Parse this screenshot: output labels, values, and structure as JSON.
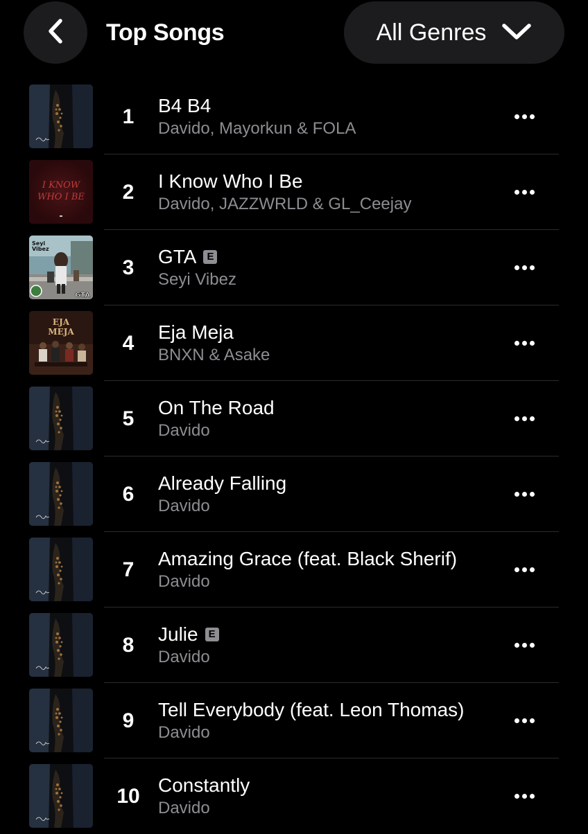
{
  "header": {
    "back_icon": "chevron-left-icon",
    "title": "Top Songs",
    "genre_label": "All Genres",
    "genre_icon": "chevron-down-icon"
  },
  "explicit_badge": "E",
  "colors": {
    "background": "#000000",
    "button_bg": "#1c1c1e",
    "secondary_text": "#8d8d92",
    "divider": "#2c2c2e"
  },
  "songs": [
    {
      "rank": "1",
      "title": "B4 B4",
      "artist": "Davido, Mayorkun & FOLA",
      "explicit": false,
      "artwork": "davido-album"
    },
    {
      "rank": "2",
      "title": "I Know Who I Be",
      "artist": "Davido, JAZZWRLD & GL_Ceejay",
      "explicit": false,
      "artwork": "i-know-who-i-be-cover",
      "artwork_text": [
        "I KNOW",
        "WHO I BE"
      ]
    },
    {
      "rank": "3",
      "title": "GTA",
      "artist": "Seyi Vibez",
      "explicit": true,
      "artwork": "gta-cover",
      "artwork_text": [
        "Seyi",
        "Vibez",
        "GTA"
      ]
    },
    {
      "rank": "4",
      "title": "Eja Meja",
      "artist": "BNXN & Asake",
      "explicit": false,
      "artwork": "eja-meja-cover",
      "artwork_text": [
        "EJA",
        "MEJA"
      ]
    },
    {
      "rank": "5",
      "title": "On The Road",
      "artist": "Davido",
      "explicit": false,
      "artwork": "davido-album"
    },
    {
      "rank": "6",
      "title": "Already Falling",
      "artist": "Davido",
      "explicit": false,
      "artwork": "davido-album"
    },
    {
      "rank": "7",
      "title": "Amazing Grace (feat. Black Sherif)",
      "artist": "Davido",
      "explicit": false,
      "artwork": "davido-album"
    },
    {
      "rank": "8",
      "title": "Julie",
      "artist": "Davido",
      "explicit": true,
      "artwork": "davido-album"
    },
    {
      "rank": "9",
      "title": "Tell Everybody (feat. Leon Thomas)",
      "artist": "Davido",
      "explicit": false,
      "artwork": "davido-album"
    },
    {
      "rank": "10",
      "title": "Constantly",
      "artist": "Davido",
      "explicit": false,
      "artwork": "davido-album"
    }
  ]
}
